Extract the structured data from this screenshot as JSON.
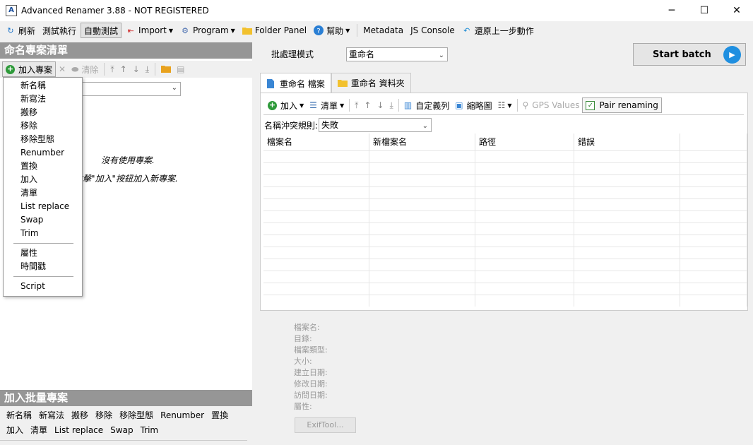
{
  "window": {
    "title": "Advanced Renamer 3.88 - NOT REGISTERED",
    "minimize": "─",
    "maximize": "☐",
    "close": "✕"
  },
  "toolbar": {
    "refresh": "刷新",
    "test_run": "測試執行",
    "auto_test": "自動測試",
    "import": "Import",
    "program": "Program",
    "folder_panel": "Folder Panel",
    "help": "幫助",
    "metadata": "Metadata",
    "js_console": "JS Console",
    "undo": "還原上一步動作"
  },
  "left_panel": {
    "header": "命名專案清單",
    "add_method": "加入專案",
    "clear": "清除",
    "empty_line1": "沒有使用專案.",
    "empty_line2": "點擊\"加入\"按鈕加入新專案."
  },
  "dropdown": {
    "group1": [
      "新名稱",
      "新寫法",
      "搬移",
      "移除",
      "移除型態",
      "Renumber",
      "置換",
      "加入",
      "清單",
      "List replace",
      "Swap",
      "Trim"
    ],
    "group2": [
      "屬性",
      "時間戳"
    ],
    "group3": [
      "Script"
    ]
  },
  "batch_panel": {
    "header": "加入批量專案",
    "row1": [
      "新名稱",
      "新寫法",
      "搬移",
      "移除",
      "移除型態",
      "Renumber",
      "置換"
    ],
    "row2": [
      "加入",
      "清單",
      "List replace",
      "Swap",
      "Trim"
    ]
  },
  "batch_mode": {
    "label": "批處理模式",
    "value": "重命名"
  },
  "start_batch": "Start batch",
  "tabs": {
    "files": "重命名 檔案",
    "folders": "重命名 資料夾"
  },
  "file_toolbar": {
    "add": "加入",
    "list": "清單",
    "custom_columns": "自定義列",
    "thumbnails": "縮略圖",
    "gps_values": "GPS Values",
    "pair_renaming": "Pair renaming"
  },
  "conflict": {
    "label": "名稱沖突規則:",
    "value": "失敗"
  },
  "grid": {
    "columns": [
      "檔案名",
      "新檔案名",
      "路徑",
      "錯誤",
      ""
    ]
  },
  "info": {
    "labels": [
      "檔案名:",
      "目錄:",
      "檔案類型:",
      "大小:",
      "建立日期:",
      "修改日期:",
      "訪問日期:",
      "屬性:"
    ],
    "exiftool": "ExifTool..."
  }
}
